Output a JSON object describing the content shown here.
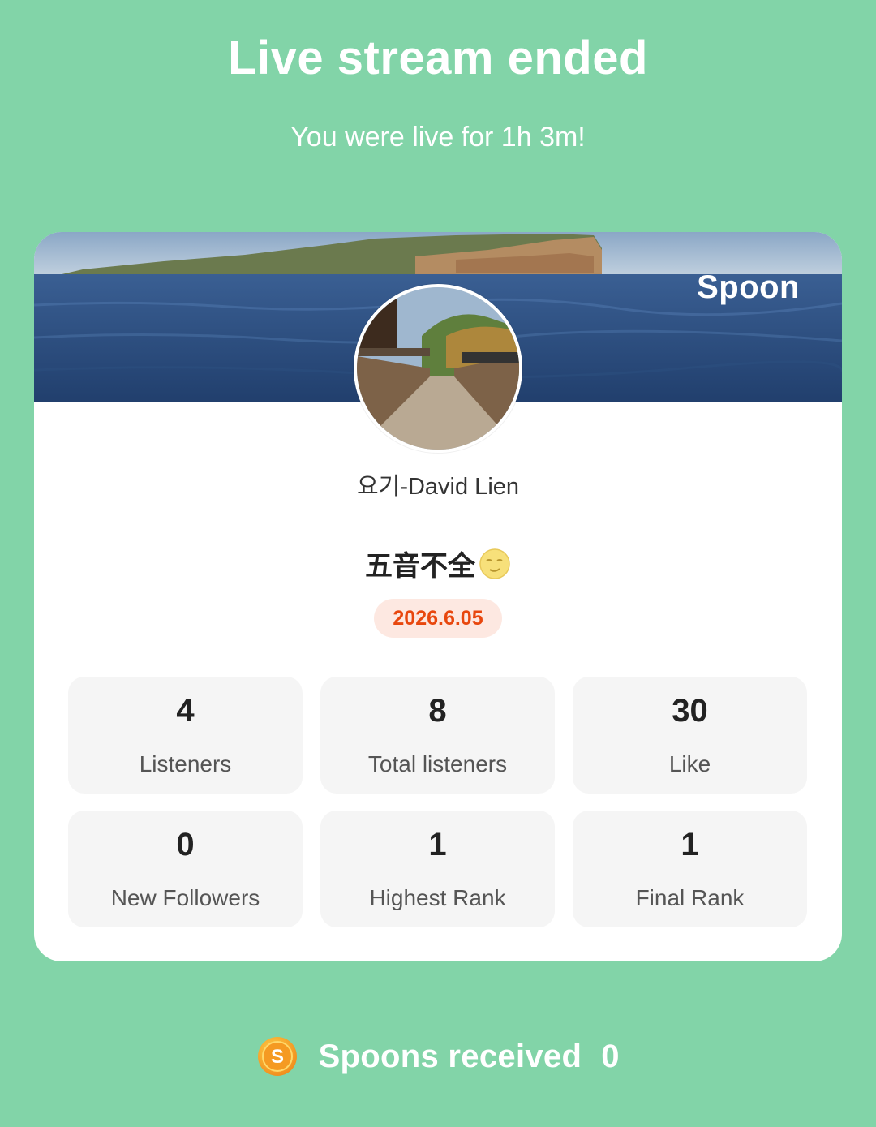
{
  "header": {
    "title": "Live stream ended",
    "subtitle": "You were live for 1h 3m!"
  },
  "card": {
    "brand": "Spoon",
    "username": "요기-David Lien",
    "stream_title": "五音不全",
    "stream_title_emoji": "moon-face-emoji",
    "date": "2026.6.05",
    "stats": [
      {
        "value": "4",
        "label": "Listeners"
      },
      {
        "value": "8",
        "label": "Total listeners"
      },
      {
        "value": "30",
        "label": "Like"
      },
      {
        "value": "0",
        "label": "New Followers"
      },
      {
        "value": "1",
        "label": "Highest Rank"
      },
      {
        "value": "1",
        "label": "Final Rank"
      }
    ]
  },
  "footer": {
    "icon": "spoon-coin-icon",
    "label": "Spoons received",
    "count": "0"
  },
  "colors": {
    "background": "#82d4a8",
    "date_badge_text": "#e8470e",
    "date_badge_bg": "#fde8e1",
    "stat_tile_bg": "#f5f5f5"
  }
}
